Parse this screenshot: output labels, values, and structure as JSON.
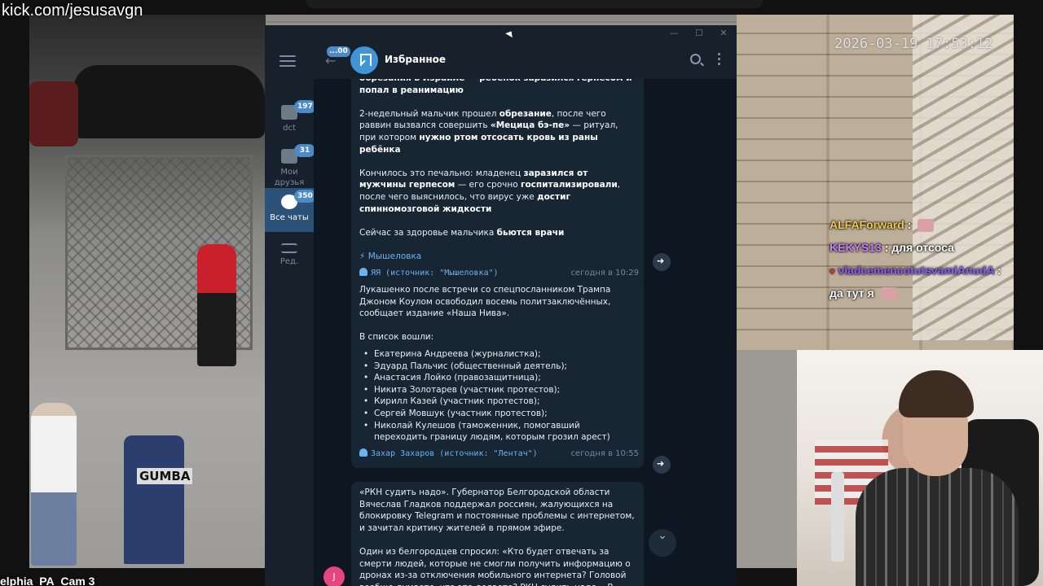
{
  "stream": {
    "url": "kick.com/jesusavgn",
    "camera_timestamp": "2026-03-19 17:53:12",
    "camera_caption": "elphia_PA_Cam 3",
    "mailbox_label": "GUMBA"
  },
  "stream_chat": [
    {
      "user": "ALFAForward",
      "user_color": "#f2c94c",
      "text": ":",
      "emote": true
    },
    {
      "user": "KEKYS13",
      "user_color": "#c97bff",
      "text": ": для отсоса",
      "emote": false
    },
    {
      "user": "vladcemencotutsvamlAnudA",
      "user_color": "#8a5cf6",
      "text": ":",
      "emote": false
    },
    {
      "user": "",
      "user_color": "#ffffff",
      "text": "да тут я",
      "emote": true
    }
  ],
  "telegram": {
    "window_controls": {
      "minimize": "—",
      "maximize": "☐",
      "close": "✕"
    },
    "rail": {
      "items": [
        {
          "label": "dct",
          "badge": "197"
        },
        {
          "label": "Мои друзья",
          "badge": "31"
        },
        {
          "label": "Все чаты",
          "badge": "350"
        },
        {
          "label": "Ред.",
          "badge": ""
        }
      ]
    },
    "header": {
      "back_badge": "...00",
      "title": "Избранное"
    },
    "messages": [
      {
        "top_fragment": "обрезания в Израиле — ребёнок заразился герпесом и попал в реанимацию",
        "p1_a": "2-недельный мальчик прошел ",
        "p1_b": "обрезание",
        "p1_c": ", после чего раввин вызвался совершить ",
        "p1_d": "«Мецица бэ-пе»",
        "p1_e": " — ритуал, при котором ",
        "p1_f": "нужно ртом отсосать кровь из раны ребёнка",
        "p2_a": "Кончилось это печально: младенец ",
        "p2_b": "заразился от мужчины герпесом",
        "p2_c": " — его срочно ",
        "p2_d": "госпитализировали",
        "p2_e": ", после чего выяснилось, что вирус уже ",
        "p2_f": "достиг спинномозговой жидкости",
        "p3_a": "Сейчас за здоровье мальчика ",
        "p3_b": "бьются врачи",
        "link": "⚡ Мышеловка",
        "author": "ЯЯ (источник: \"Мышеловка\")",
        "time": "сегодня в 10:29"
      },
      {
        "p1": "Лукашенко после встречи со спецпосланником Трампа Джоном Коулом освободил восемь политзаключённых, сообщает издание «Наша Нива».",
        "p2": "В список вошли:",
        "list": [
          "Екатерина Андреева (журналистка);",
          "Эдуард Пальчис (общественный деятель);",
          "Анастасия Лойко (правозащитница);",
          "Никита Золотарев (участник протестов);",
          "Кирилл Казей (участник протестов);",
          "Сергей Мовшук (участник протестов);",
          "Николай Кулешов (таможенник, помогавший переходить границу людям, которым грозил арест)"
        ],
        "author": "Захар Захаров (источник: \"Лентач\")",
        "time": "сегодня в 10:55"
      },
      {
        "p1": "«РКН судить надо». Губернатор Белгородской области Вячеслав Гладков поддержал россиян, жалующихся на блокировку Telegram и постоянные проблемы с интернетом, и зачитал критику жителей в прямом эфире.",
        "p2": "Один из белгородцев спросил: «Кто будет отвечать за смерти людей, которые не смогли получить информацию о дронах из-за отключения мобильного интернета? Головой вообще думаете, что это делаете? РКН судить надо... В этот раз на"
      }
    ],
    "avatar_letter": "J",
    "scroll_down": "⌄"
  }
}
